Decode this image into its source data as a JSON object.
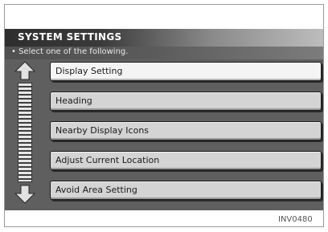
{
  "screen": {
    "title": "SYSTEM SETTINGS",
    "subtitle": "• Select one of the following."
  },
  "menu": {
    "items": [
      {
        "label": "Display Setting",
        "selected": true
      },
      {
        "label": "Heading",
        "selected": false
      },
      {
        "label": "Nearby Display Icons",
        "selected": false
      },
      {
        "label": "Adjust Current Location",
        "selected": false
      },
      {
        "label": "Avoid Area Setting",
        "selected": false
      }
    ]
  },
  "icons": {
    "up": "scroll-up-arrow-icon",
    "down": "scroll-down-arrow-icon"
  },
  "figure": {
    "caption": "INV0480"
  },
  "colors": {
    "screen_bg": "#5f5f5f",
    "item_bg": "#d4d4d4",
    "item_selected_bg": "#f4f4f4",
    "title_text": "#ffffff"
  }
}
